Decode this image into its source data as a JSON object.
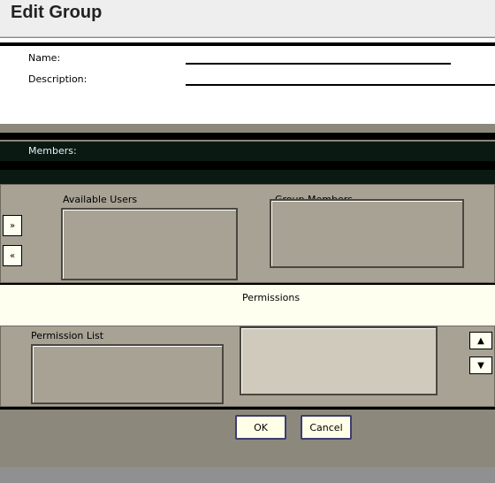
{
  "window": {
    "title": "Edit Group"
  },
  "form": {
    "name_label": "Name:",
    "name_value": "",
    "description_label": "Description:",
    "description_value": ""
  },
  "members": {
    "section_label": "Members:",
    "available_label": "Available Users",
    "selected_label": "Group Members",
    "add_label": "»",
    "remove_label": "«"
  },
  "permissions": {
    "section_label": "Permissions",
    "list_label": "Permission List",
    "up_label": "▲",
    "down_label": "▼"
  },
  "buttons": {
    "ok": "OK",
    "cancel": "Cancel"
  }
}
